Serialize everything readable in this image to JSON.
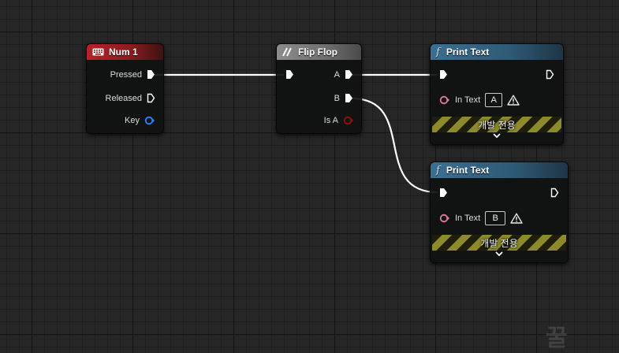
{
  "nodes": {
    "num1": {
      "title": "Num 1",
      "pins": {
        "pressed": "Pressed",
        "released": "Released",
        "key": "Key"
      }
    },
    "flipflop": {
      "title": "Flip Flop",
      "pins": {
        "a": "A",
        "b": "B",
        "is_a": "Is A"
      }
    },
    "print1": {
      "title": "Print Text",
      "in_text_label": "In Text",
      "in_text_value": "A",
      "dev_only": "개발 전용"
    },
    "print2": {
      "title": "Print Text",
      "in_text_label": "In Text",
      "in_text_value": "B",
      "dev_only": "개발 전용"
    }
  },
  "icons": {
    "key": "keyboard-icon",
    "flipflop": "flipflop-icon",
    "function": "function-icon",
    "warning": "warning-icon",
    "expand": "chevron-down-icon"
  },
  "colors": {
    "exec_wire": "#ffffff",
    "key_pin": "#2e84ff",
    "bool_pin": "#9a0d0d",
    "text_pin": "#e07aa0",
    "event_header": "#b5222a",
    "flow_header": "#8c8c8c",
    "function_header": "#3b6f92"
  },
  "watermark": "꿀"
}
